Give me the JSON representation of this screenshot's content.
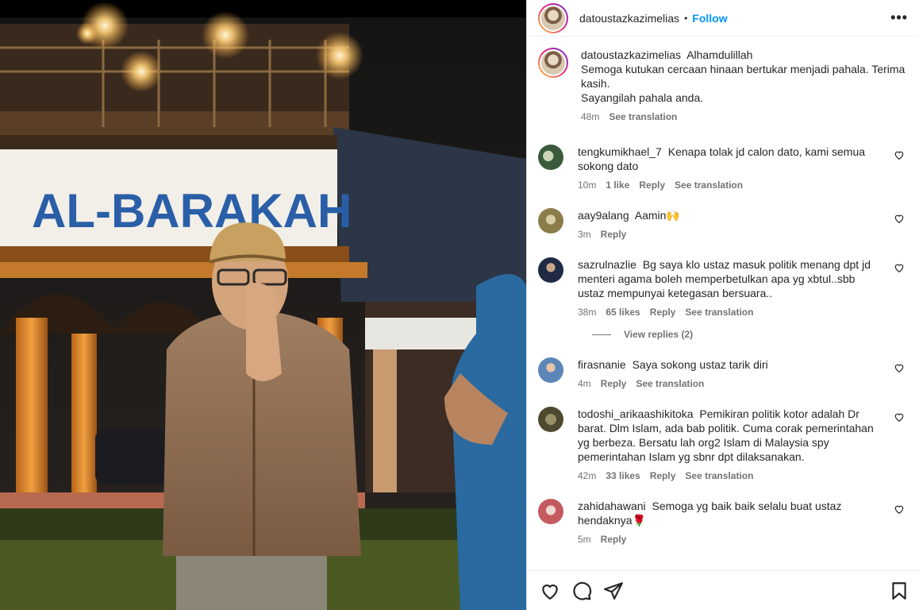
{
  "post": {
    "username": "datoustazkazimelias",
    "follow_label": "Follow",
    "dot": "•",
    "more": "•••"
  },
  "photo": {
    "sign_text": "AL-BARAKAH"
  },
  "caption": {
    "username": "datoustazkazimelias",
    "text": "Alhamdulillah",
    "line2": "Semoga kutukan cercaan hinaan bertukar menjadi pahala. Terima kasih.",
    "line3": "Sayangilah pahala anda.",
    "time": "48m",
    "see_translation": "See translation"
  },
  "comments": [
    {
      "username": "tengkumikhael_7",
      "text": "Kenapa tolak jd calon dato, kami semua sokong dato",
      "time": "10m",
      "likes": "1 like",
      "reply": "Reply",
      "translation": "See translation",
      "avatar_color": "#5a7a5a"
    },
    {
      "username": "aay9alang",
      "text": "Aamin🙌",
      "time": "3m",
      "likes": "",
      "reply": "Reply",
      "translation": "",
      "avatar_color": "#a89b6a"
    },
    {
      "username": "sazrulnazlie",
      "text": "Bg saya klo ustaz masuk politik menang dpt jd menteri agama boleh memperbetulkan apa yg xbtul..sbb ustaz mempunyai ketegasan bersuara..",
      "time": "38m",
      "likes": "65 likes",
      "reply": "Reply",
      "translation": "See translation",
      "avatar_color": "#2b3a55"
    },
    {
      "username": "firasnanie",
      "text": "Saya sokong ustaz tarik diri",
      "time": "4m",
      "likes": "",
      "reply": "Reply",
      "translation": "See translation",
      "avatar_color": "#6b8fb8"
    },
    {
      "username": "todoshi_arikaashikitoka",
      "text": "Pemikiran politik kotor adalah Dr barat. Dlm Islam, ada bab politik. Cuma corak pemerintahan yg berbeza. Bersatu lah org2 Islam di Malaysia spy pemerintahan Islam yg sbnr dpt dilaksanakan.",
      "time": "42m",
      "likes": "33 likes",
      "reply": "Reply",
      "translation": "See translation",
      "avatar_color": "#6f6a4a"
    },
    {
      "username": "zahidahawani",
      "text": "Semoga yg baik baik selalu buat ustaz hendaknya🌹",
      "time": "5m",
      "likes": "",
      "reply": "Reply",
      "translation": "",
      "avatar_color": "#c9a5a0"
    }
  ],
  "view_replies": "View replies (2)",
  "colors": {
    "accent": "#0095f6",
    "muted": "#737373",
    "text": "#262626"
  }
}
